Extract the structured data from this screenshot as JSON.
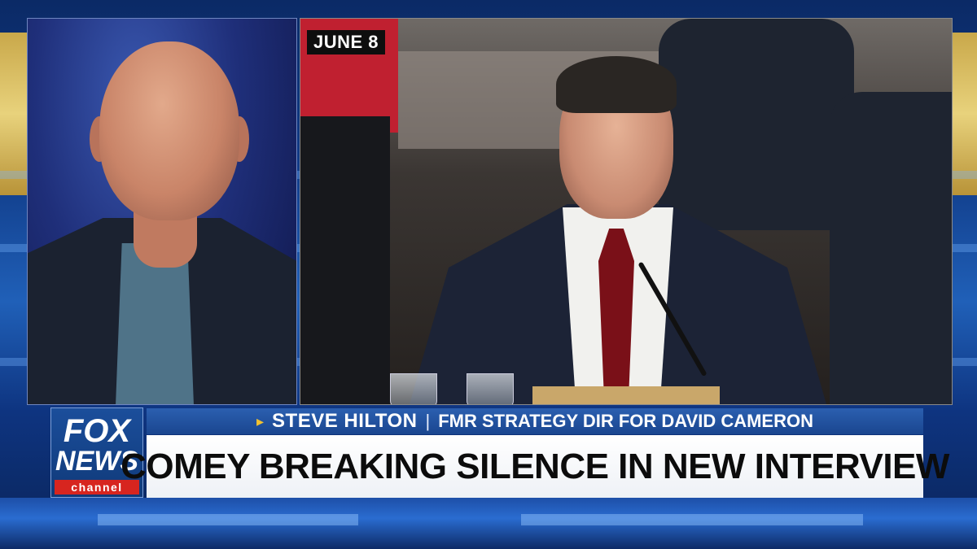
{
  "screen": {
    "date_tag": "JUNE 8"
  },
  "lower_third": {
    "logo": {
      "line1": "FOX",
      "line2": "NEWS",
      "line3": "channel"
    },
    "name_arrow": "▸",
    "guest_name": "STEVE HILTON",
    "separator": "|",
    "guest_title": "FMR STRATEGY DIR FOR DAVID CAMERON",
    "headline": "COMEY BREAKING SILENCE IN NEW INTERVIEW"
  },
  "colors": {
    "brand_blue": "#1a468f",
    "headline_bg": "#ffffff",
    "logo_red": "#d7251f",
    "arrow_gold": "#f2c230"
  }
}
